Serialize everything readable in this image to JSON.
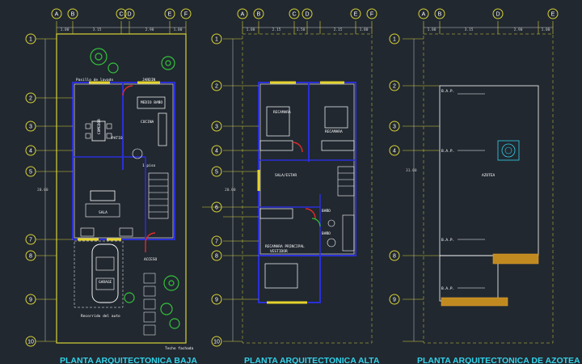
{
  "plans": [
    {
      "title": "PLANTA ARQUITECTONICA BAJA"
    },
    {
      "title": "PLANTA ARQUITECTONICA ALTA"
    },
    {
      "title": "PLANTA ARQUITECTONICA DE AZOTEA"
    }
  ],
  "axes": {
    "columns_p1": [
      "A",
      "B",
      "C",
      "D",
      "E",
      "F"
    ],
    "columns_p2": [
      "A",
      "B",
      "C",
      "D",
      "E",
      "F"
    ],
    "columns_p3": [
      "A",
      "B",
      "D",
      "E"
    ],
    "rows_p1": [
      "1",
      "2",
      "3",
      "4",
      "5",
      "7",
      "8",
      "9",
      "10"
    ],
    "rows_p2": [
      "1",
      "2",
      "3",
      "4",
      "5",
      "6",
      "7",
      "8",
      "9",
      "10"
    ],
    "rows_p3": [
      "1",
      "2",
      "3",
      "4",
      "8",
      "9"
    ]
  },
  "dims": {
    "p1_top": [
      "1.00",
      "3.15",
      "2.90",
      "1.00"
    ],
    "p1_total": "20.00",
    "p2_top": [
      "1.00",
      "2.15",
      "1.50",
      "2.15",
      "1.00"
    ],
    "p2_total": "20.00",
    "p3_top": [
      "1.00",
      "3.15",
      "2.90",
      "1.00"
    ],
    "p3_total": "31.00"
  },
  "rooms": {
    "p1": [
      "COCINA",
      "SALA",
      "COMEDOR",
      "GARAGE",
      "ACCESO",
      "PATIO",
      "1 piso",
      "JARDIN",
      "MEDIO BAÑO"
    ],
    "p2": [
      "RECAMARA",
      "RECAMARA",
      "SALA/ESTAR",
      "BAÑO",
      "BAÑO",
      "RECAMARA PRINCIPAL",
      "VESTIDOR"
    ],
    "p3": [
      "AZOTEA",
      "B.A.P.",
      "B.A.P.",
      "B.A.P.",
      "B.A.P."
    ]
  },
  "labels": {
    "p1_bottom": "Pasillo de lavado",
    "p1_garage": "Recorrido del auto",
    "p1_footer": "Techo fachada"
  },
  "colors": {
    "background": "#212830",
    "title": "#32d3ea",
    "wall": "#2a2fd8",
    "axis": "#d8d235",
    "tree": "#34c23a",
    "door": "#e12a2a",
    "dimension": "#c9c9c9"
  }
}
